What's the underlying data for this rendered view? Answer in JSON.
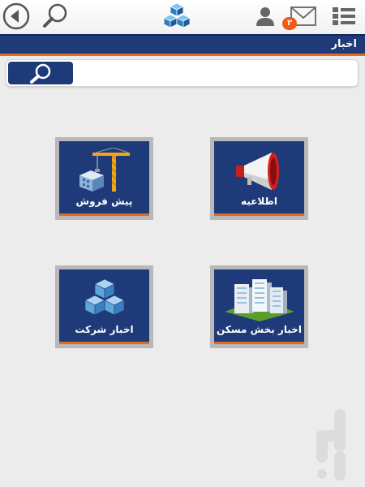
{
  "header": {
    "icons": {
      "back": "back-arrow-icon",
      "search": "search-icon",
      "logo": "cubes-logo-icon",
      "user": "user-icon",
      "mail": "mail-icon",
      "menu": "grid-menu-icon"
    },
    "mail_badge": "۳"
  },
  "titlebar": {
    "title": "اخبار"
  },
  "search": {
    "placeholder": "",
    "value": ""
  },
  "tiles": [
    {
      "label": "پیش فروش",
      "icon": "construction-crane-icon"
    },
    {
      "label": "اطلاعیه",
      "icon": "megaphone-icon"
    },
    {
      "label": "اخبار شرکت",
      "icon": "cubes-icon"
    },
    {
      "label": "اخبار بخش مسکن",
      "icon": "buildings-icon"
    }
  ],
  "colors": {
    "primary": "#1e3a78",
    "accent": "#e56a1e",
    "background": "#ececec",
    "tile_frame": "#b9b9b9"
  }
}
